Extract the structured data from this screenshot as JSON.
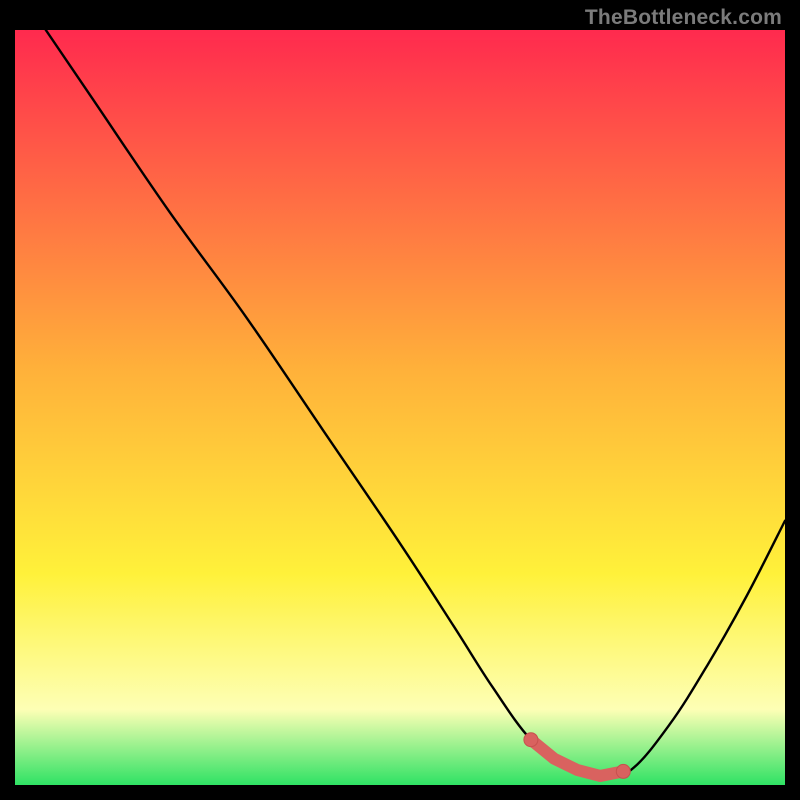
{
  "watermark": "TheBottleneck.com",
  "colors": {
    "black": "#000000",
    "curve": "#000000",
    "marker_fill": "#d9625f",
    "marker_stroke": "#c7514e",
    "gradient_top": "#ff2a4e",
    "gradient_mid1": "#ffb13a",
    "gradient_mid2": "#fff13a",
    "gradient_mid3": "#fdffb5",
    "gradient_bottom": "#2fe264"
  },
  "chart_data": {
    "type": "line",
    "title": "",
    "xlabel": "",
    "ylabel": "",
    "xlim": [
      0,
      100
    ],
    "ylim": [
      0,
      100
    ],
    "grid": false,
    "legend": false,
    "series": [
      {
        "name": "bottleneck-curve",
        "x": [
          4,
          10,
          20,
          30,
          40,
          50,
          57,
          62,
          67,
          72,
          76,
          80,
          85,
          90,
          95,
          100
        ],
        "values": [
          100,
          91,
          76,
          62,
          47,
          32,
          21,
          13,
          6,
          2,
          1,
          2,
          8,
          16,
          25,
          35
        ]
      }
    ],
    "markers": {
      "name": "optimal-range-markers",
      "x": [
        67,
        70,
        73,
        76,
        79
      ],
      "values": [
        6,
        3.5,
        2,
        1.2,
        1.8
      ]
    }
  }
}
